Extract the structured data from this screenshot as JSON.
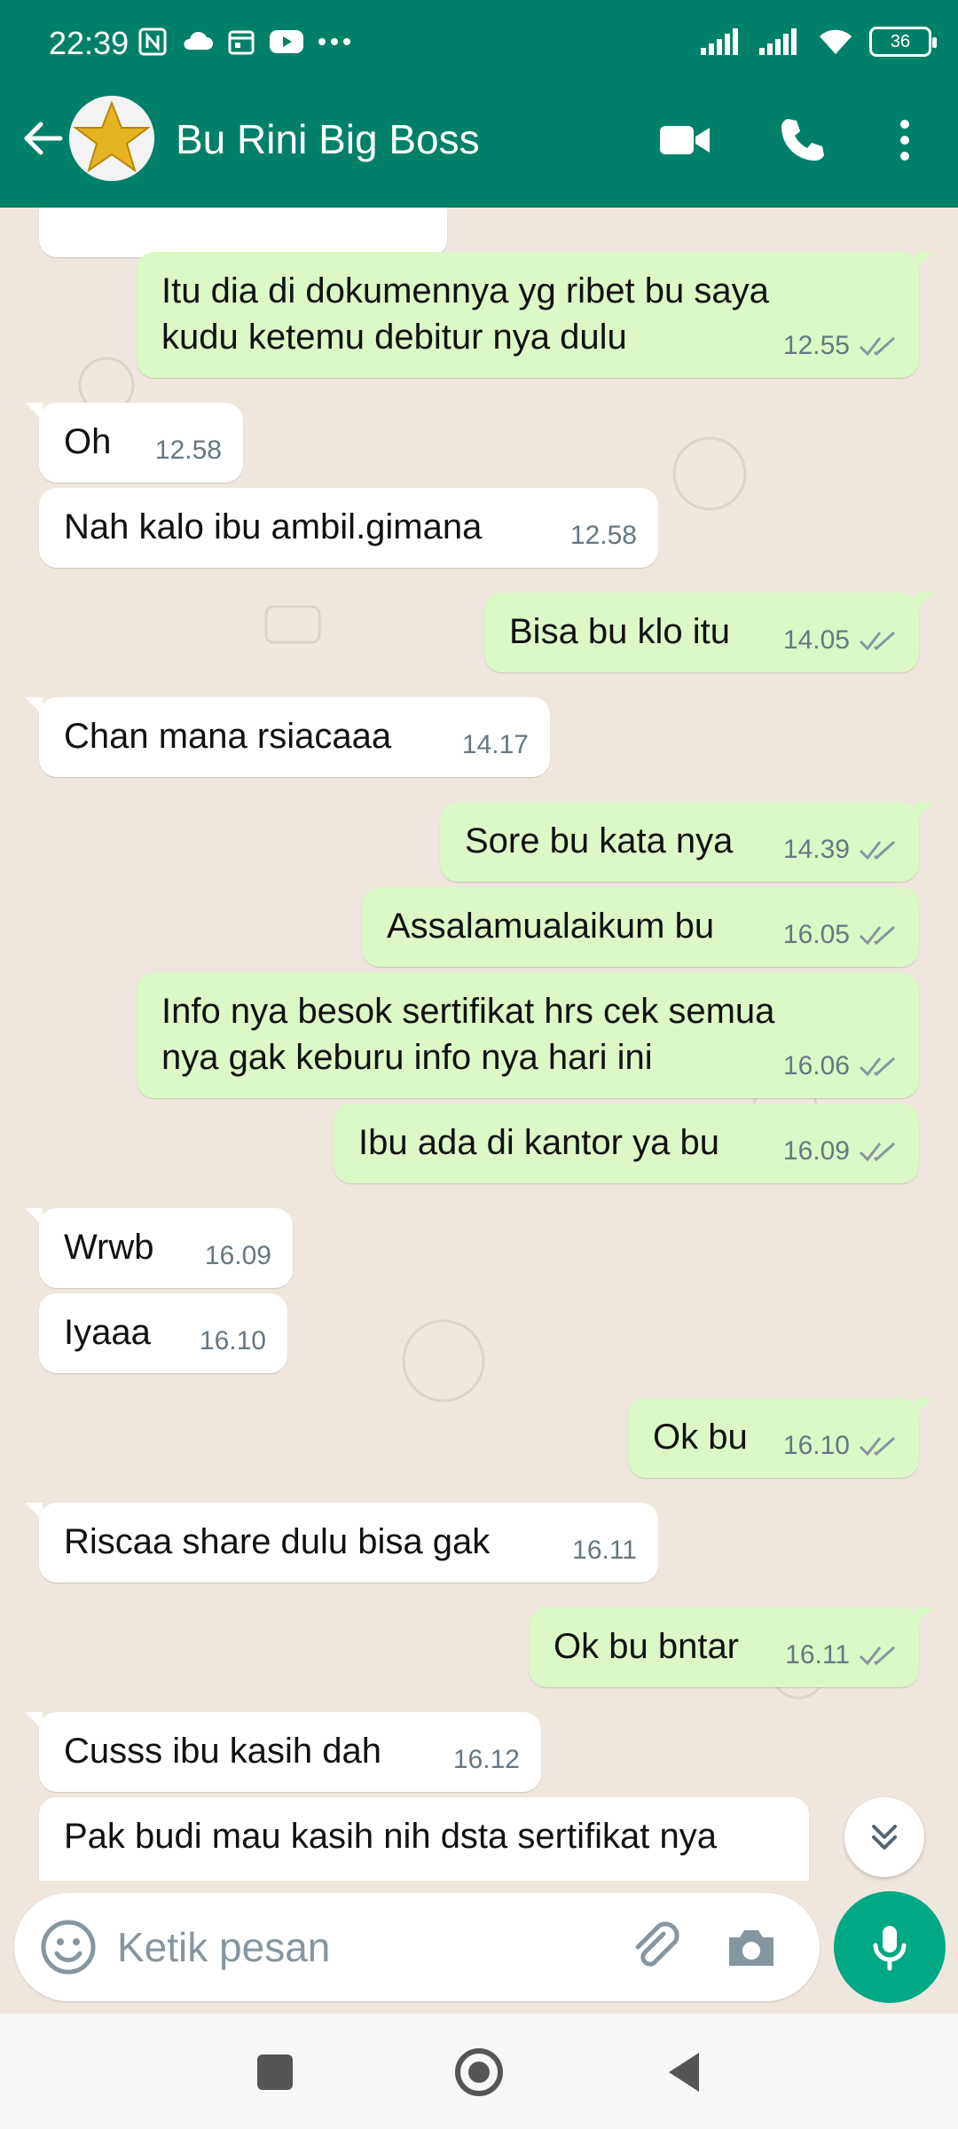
{
  "status": {
    "time": "22:39",
    "battery": "36"
  },
  "header": {
    "contact_name": "Bu Rini Big Boss"
  },
  "composer": {
    "placeholder": "Ketik pesan"
  },
  "messages": [
    {
      "dir": "out",
      "text_lines": [
        "Itu dia di dokumennya yg ribet bu saya",
        "kudu ketemu debitur nya dulu"
      ],
      "time": "12.55"
    },
    {
      "dir": "in",
      "text": "Oh",
      "time": "12.58"
    },
    {
      "dir": "in",
      "text": "Nah kalo ibu ambil.gimana",
      "time": "12.58"
    },
    {
      "dir": "out",
      "text": "Bisa bu klo itu",
      "time": "14.05"
    },
    {
      "dir": "in",
      "text": "Chan mana rsiacaaa",
      "time": "14.17"
    },
    {
      "dir": "out",
      "text": "Sore bu kata nya",
      "time": "14.39"
    },
    {
      "dir": "out",
      "text": "Assalamualaikum bu",
      "time": "16.05"
    },
    {
      "dir": "out",
      "text_lines": [
        "Info nya besok sertifikat hrs cek semua",
        "nya gak keburu info nya hari ini"
      ],
      "time": "16.06"
    },
    {
      "dir": "out",
      "text": "Ibu ada di kantor ya bu",
      "time": "16.09"
    },
    {
      "dir": "in",
      "text": "Wrwb",
      "time": "16.09"
    },
    {
      "dir": "in",
      "text": "Iyaaa",
      "time": "16.10"
    },
    {
      "dir": "out",
      "text": "Ok bu",
      "time": "16.10"
    },
    {
      "dir": "in",
      "text": "Riscaa share dulu bisa gak",
      "time": "16.11"
    },
    {
      "dir": "out",
      "text": "Ok bu bntar",
      "time": "16.11"
    },
    {
      "dir": "in",
      "text": "Cusss ibu kasih dah",
      "time": "16.12"
    },
    {
      "dir": "in",
      "text": "Pak budi mau kasih nih dsta sertifikat nya",
      "time": ""
    }
  ]
}
